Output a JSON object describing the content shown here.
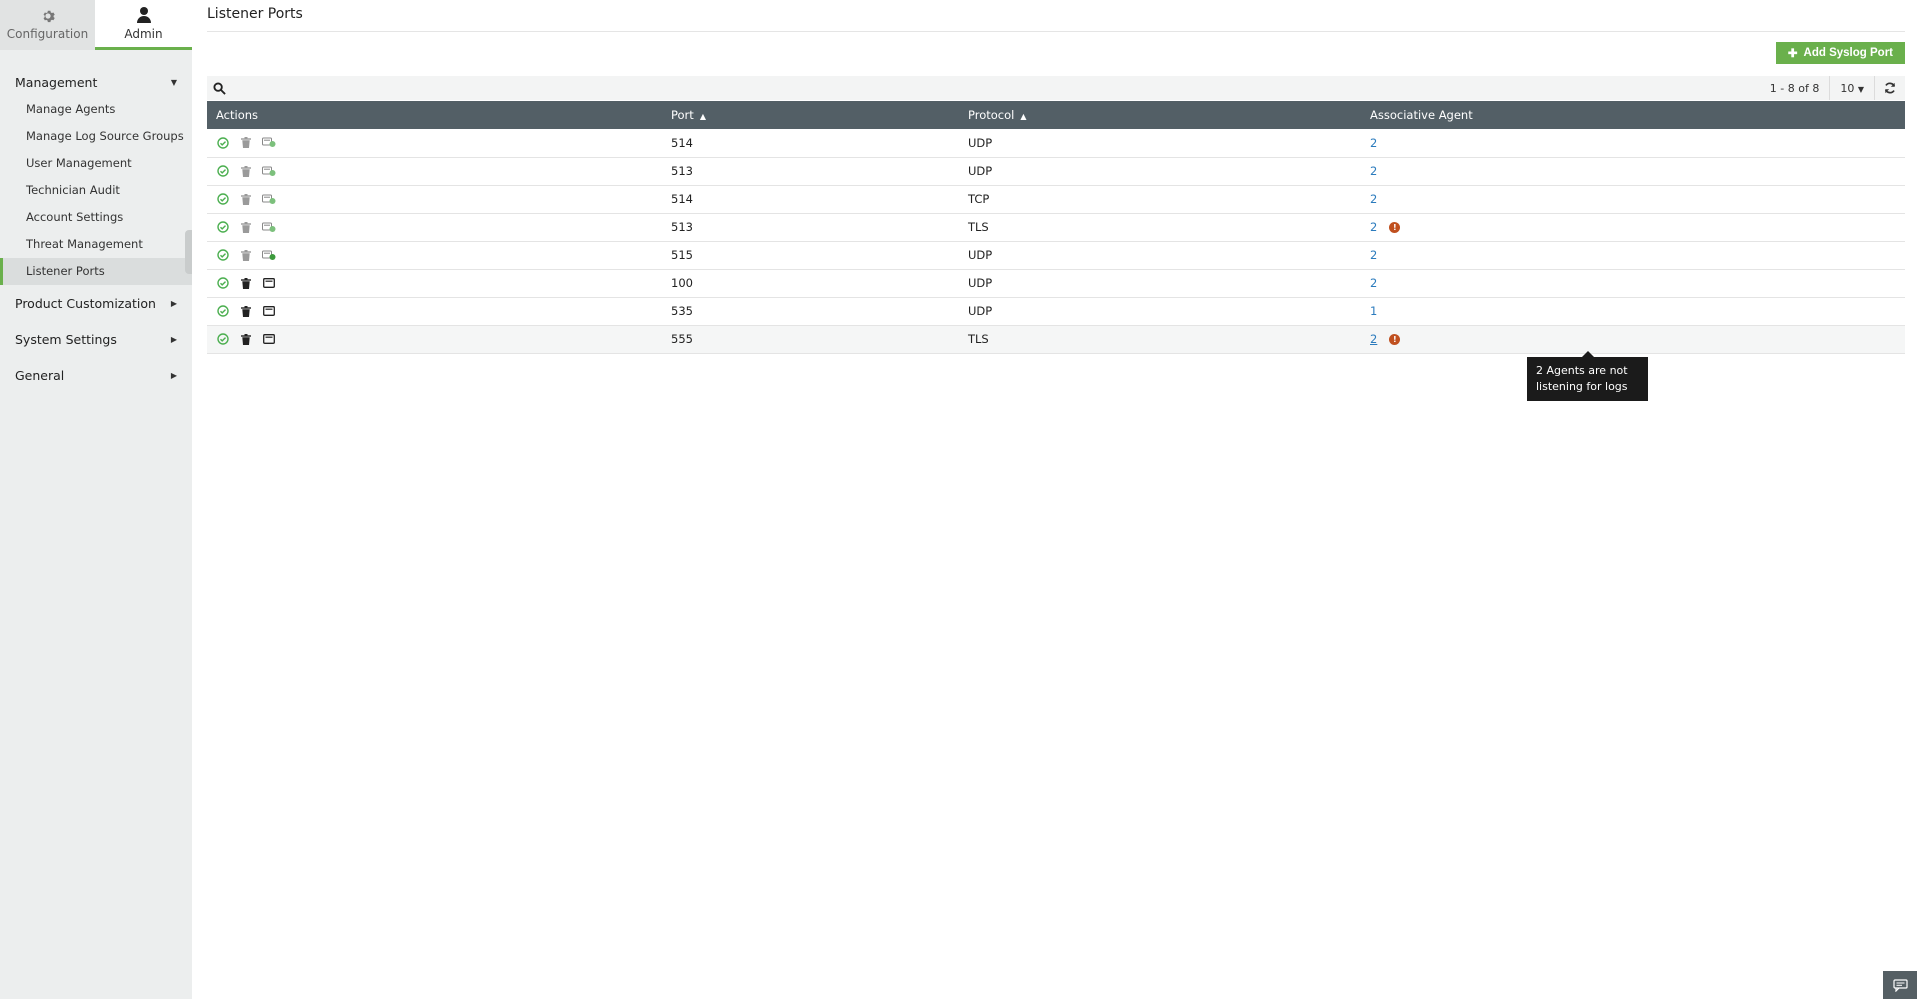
{
  "nav": {
    "tabs": [
      {
        "label": "Configuration",
        "icon": "gear-icon"
      },
      {
        "label": "Admin",
        "icon": "user-icon"
      }
    ]
  },
  "sidebar": {
    "sections": [
      {
        "label": "Management",
        "expanded": true,
        "items": [
          "Manage Agents",
          "Manage Log Source Groups",
          "User Management",
          "Technician Audit",
          "Account Settings",
          "Threat Management",
          "Listener Ports"
        ],
        "active_item": "Listener Ports"
      },
      {
        "label": "Product Customization",
        "expanded": false
      },
      {
        "label": "System Settings",
        "expanded": false
      },
      {
        "label": "General",
        "expanded": false
      }
    ]
  },
  "page": {
    "title": "Listener Ports",
    "add_button_label": "Add Syslog Port",
    "pagination": "1 - 8 of 8",
    "per_page": "10"
  },
  "table": {
    "columns": [
      "Actions",
      "Port",
      "Protocol",
      "Associative Agent"
    ],
    "rows": [
      {
        "port": "514",
        "protocol": "UDP",
        "agents": "2",
        "warning": false,
        "muted": true
      },
      {
        "port": "513",
        "protocol": "UDP",
        "agents": "2",
        "warning": false,
        "muted": true
      },
      {
        "port": "514",
        "protocol": "TCP",
        "agents": "2",
        "warning": false,
        "muted": true
      },
      {
        "port": "513",
        "protocol": "TLS",
        "agents": "2",
        "warning": true,
        "muted": true
      },
      {
        "port": "515",
        "protocol": "UDP",
        "agents": "2",
        "warning": false,
        "muted": true
      },
      {
        "port": "100",
        "protocol": "UDP",
        "agents": "2",
        "warning": false,
        "muted": false
      },
      {
        "port": "535",
        "protocol": "UDP",
        "agents": "1",
        "warning": false,
        "muted": false
      },
      {
        "port": "555",
        "protocol": "TLS",
        "agents": "2",
        "warning": true,
        "muted": false
      }
    ]
  },
  "tooltip": {
    "line1": "2 Agents are not",
    "line2": "listening for logs"
  },
  "colors": {
    "accent": "#6ab04c",
    "header_bg": "#535f66",
    "link": "#2b7bbd",
    "warning": "#c0501f"
  }
}
